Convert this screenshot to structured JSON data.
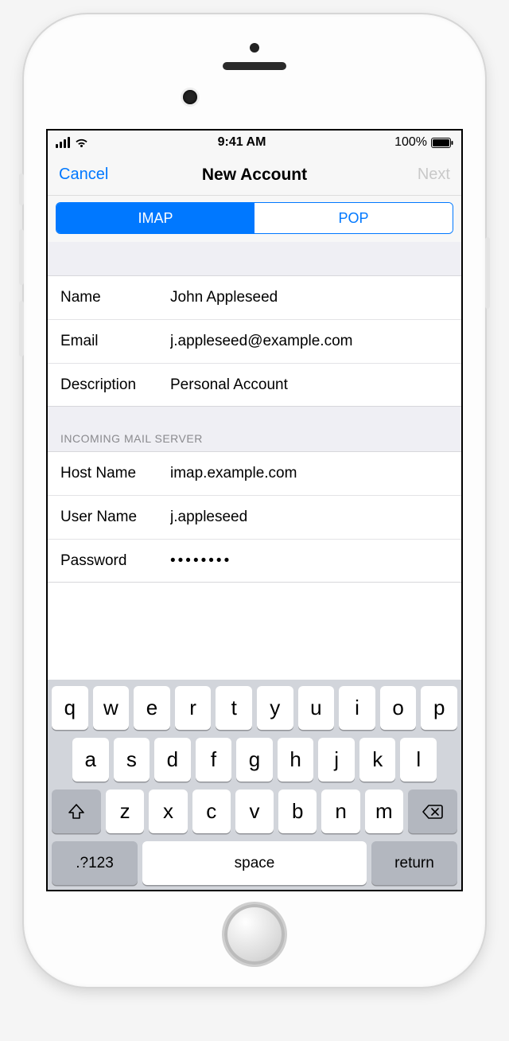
{
  "status": {
    "time": "9:41 AM",
    "battery_pct": "100%"
  },
  "nav": {
    "cancel": "Cancel",
    "title": "New Account",
    "next": "Next"
  },
  "segments": {
    "imap": "IMAP",
    "pop": "POP"
  },
  "account": {
    "name_label": "Name",
    "name_value": "John Appleseed",
    "email_label": "Email",
    "email_value": "j.appleseed@example.com",
    "desc_label": "Description",
    "desc_value": "Personal Account"
  },
  "incoming": {
    "header": "INCOMING MAIL SERVER",
    "host_label": "Host Name",
    "host_value": "imap.example.com",
    "user_label": "User Name",
    "user_value": "j.appleseed",
    "pass_label": "Password",
    "pass_value": "••••••••"
  },
  "keyboard": {
    "row1": [
      "q",
      "w",
      "e",
      "r",
      "t",
      "y",
      "u",
      "i",
      "o",
      "p"
    ],
    "row2": [
      "a",
      "s",
      "d",
      "f",
      "g",
      "h",
      "j",
      "k",
      "l"
    ],
    "row3": [
      "z",
      "x",
      "c",
      "v",
      "b",
      "n",
      "m"
    ],
    "numbers": ".?123",
    "space": "space",
    "return": "return"
  }
}
